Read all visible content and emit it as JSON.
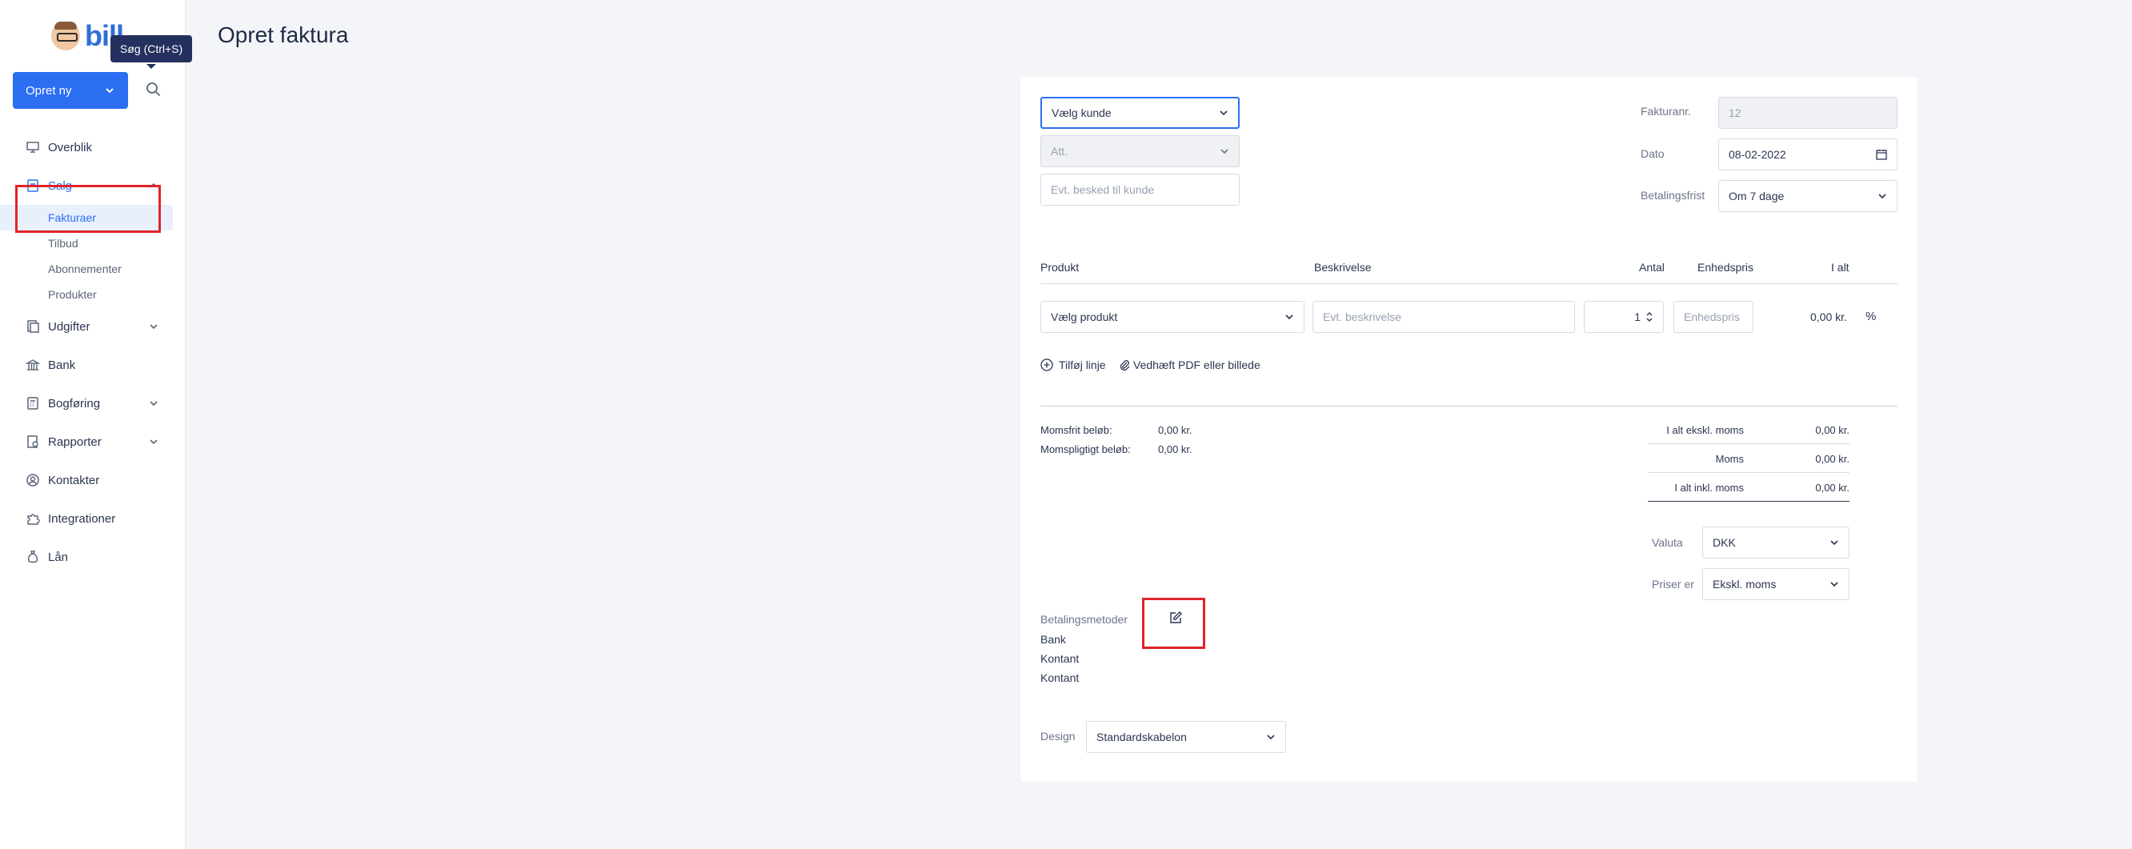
{
  "app": {
    "logo_text": "bill",
    "tooltip": "Søg (Ctrl+S)",
    "create_button": "Opret ny"
  },
  "nav": {
    "overblik": "Overblik",
    "salg": "Salg",
    "salg_sub": [
      "Fakturaer",
      "Tilbud",
      "Abonnementer",
      "Produkter"
    ],
    "udgifter": "Udgifter",
    "bank": "Bank",
    "bogforing": "Bogføring",
    "rapporter": "Rapporter",
    "kontakter": "Kontakter",
    "integrationer": "Integrationer",
    "laan": "Lån"
  },
  "page": {
    "title": "Opret faktura"
  },
  "invoice": {
    "customer_select": "Vælg kunde",
    "att_select": "Att.",
    "message_placeholder": "Evt. besked til kunde",
    "invoice_no_label": "Fakturanr.",
    "invoice_no": "12",
    "date_label": "Dato",
    "date": "08-02-2022",
    "payment_term_label": "Betalingsfrist",
    "payment_term": "Om 7 dage"
  },
  "lines": {
    "headers": {
      "product": "Produkt",
      "description": "Beskrivelse",
      "qty": "Antal",
      "unit_price": "Enhedspris",
      "total": "I alt"
    },
    "product_select": "Vælg produkt",
    "description_placeholder": "Evt. beskrivelse",
    "qty": "1",
    "unit_price_placeholder": "Enhedspris",
    "total": "0,00 kr.",
    "percent_symbol": "%",
    "add_line": "Tilføj linje",
    "attach": "Vedhæft PDF eller billede"
  },
  "totals": {
    "vat_free_label": "Momsfrit beløb:",
    "vat_free": "0,00 kr.",
    "vat_liable_label": "Momspligtigt beløb:",
    "vat_liable": "0,00 kr.",
    "excl_label": "I alt ekskl. moms",
    "excl": "0,00 kr.",
    "vat_label": "Moms",
    "vat": "0,00 kr.",
    "incl_label": "I alt inkl. moms",
    "incl": "0,00 kr."
  },
  "settings": {
    "currency_label": "Valuta",
    "currency": "DKK",
    "prices_label": "Priser er",
    "prices": "Ekskl. moms",
    "design_label": "Design",
    "design": "Standardskabelon"
  },
  "payment": {
    "label": "Betalingsmetoder",
    "methods": [
      "Bank",
      "Kontant",
      "Kontant"
    ]
  },
  "colors": {
    "accent": "#2b6ef2",
    "highlight": "#e0242a",
    "tooltip_bg": "#24305e"
  }
}
